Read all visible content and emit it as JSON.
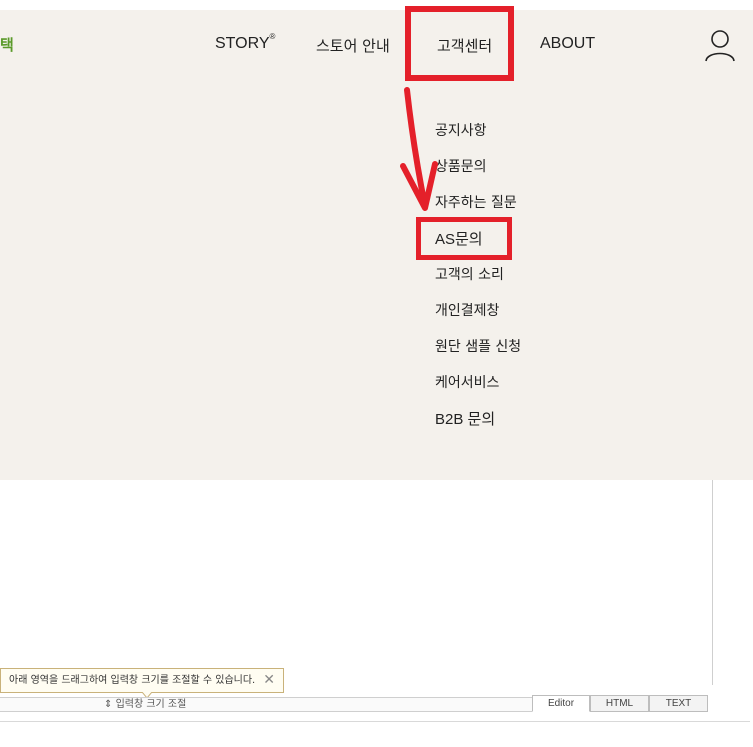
{
  "header": {
    "brand_fragment": "택",
    "nav": {
      "story": "STORY",
      "story_mark": "®",
      "store": "스토어 안내",
      "customer_center": "고객센터",
      "about": "ABOUT"
    },
    "user_icon": "user-icon"
  },
  "submenu": {
    "items": [
      "공지사항",
      "상품문의",
      "자주하는 질문",
      "AS문의",
      "고객의 소리",
      "개인결제창",
      "원단 샘플 신청",
      "케어서비스",
      "B2B 문의"
    ]
  },
  "annotations": {
    "color": "#e4202a",
    "highlighted": [
      "고객센터",
      "AS문의"
    ]
  },
  "editor": {
    "tooltip_text": "아래 영역을 드래그하여 입력창 크기를 조절할 수 있습니다.",
    "tooltip_close": "✕",
    "resize_label": "입력창 크기 조절",
    "resize_icon": "⇕",
    "tabs": [
      "Editor",
      "HTML",
      "TEXT"
    ]
  },
  "colors": {
    "header_bg": "#f4f1ec",
    "brand_green": "#5a9a2a"
  }
}
